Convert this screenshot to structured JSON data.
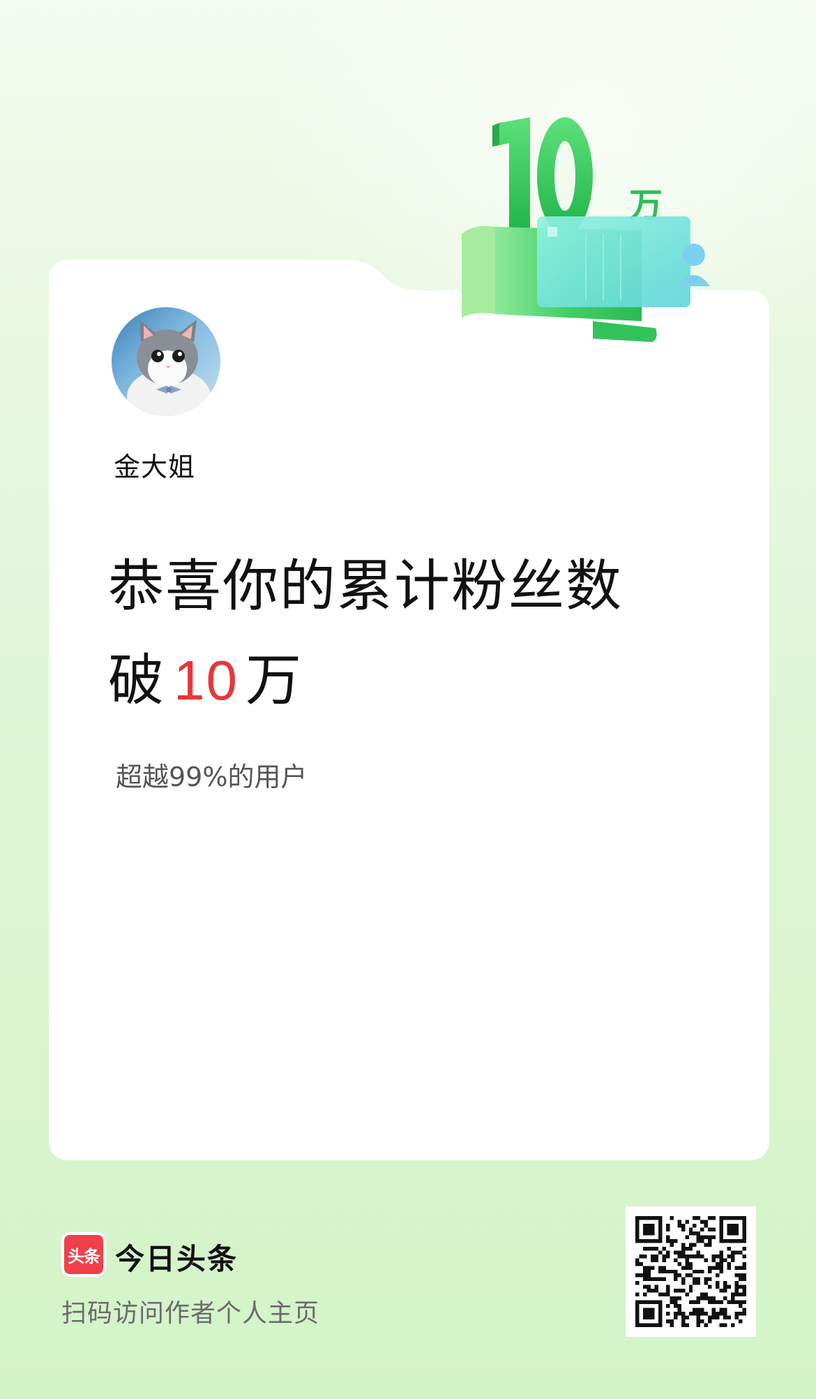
{
  "card": {
    "badge_number": "10",
    "badge_unit": "万",
    "username": "金大姐",
    "headline_line1": "恭喜你的累计粉丝数",
    "headline_line2_prefix": "破",
    "headline_line2_number": "10",
    "headline_line2_suffix": "万",
    "subline": "超越99%的用户"
  },
  "footer": {
    "app_logo_text": "头条",
    "app_name": "今日头条",
    "hint": "扫码访问作者个人主页",
    "qr_icon": "qr-code"
  },
  "colors": {
    "highlight_number": "#e8363a",
    "badge_green": "#3ccf5e",
    "brand_red": "#f1404b"
  }
}
